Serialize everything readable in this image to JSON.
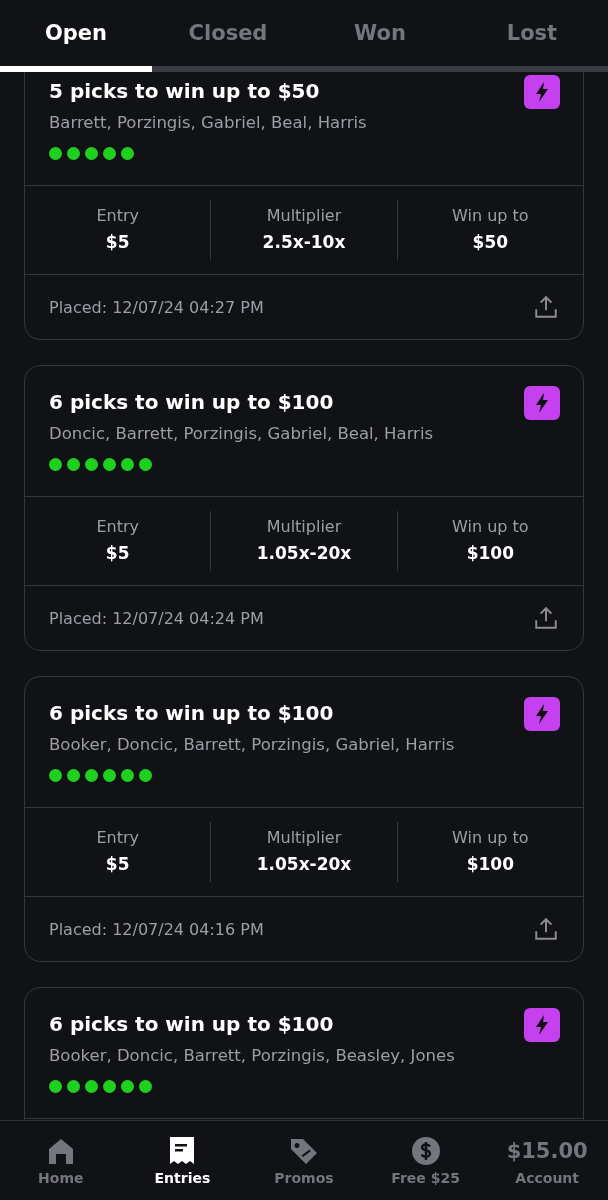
{
  "tabs": [
    {
      "label": "Open",
      "selected": true
    },
    {
      "label": "Closed",
      "selected": false
    },
    {
      "label": "Won",
      "selected": false
    },
    {
      "label": "Lost",
      "selected": false
    }
  ],
  "entries": [
    {
      "title": "5 picks to win up to $50",
      "players": "Barrett, Porzingis, Gabriel, Beal, Harris",
      "legs": [
        {
          "color": "#1fd11f"
        },
        {
          "color": "#1fd11f"
        },
        {
          "color": "#1fd11f"
        },
        {
          "color": "#1fd11f"
        },
        {
          "color": "#1fd11f"
        }
      ],
      "stats": [
        {
          "label": "Entry",
          "value": "$5"
        },
        {
          "label": "Multiplier",
          "value": "2.5x-10x"
        },
        {
          "label": "Win up to",
          "value": "$50"
        }
      ],
      "placed": "Placed: 12/07/24 04:27 PM"
    },
    {
      "title": "6 picks to win up to $100",
      "players": "Doncic, Barrett, Porzingis, Gabriel, Beal, Harris",
      "legs": [
        {
          "color": "#1fd11f"
        },
        {
          "color": "#1fd11f"
        },
        {
          "color": "#1fd11f"
        },
        {
          "color": "#1fd11f"
        },
        {
          "color": "#1fd11f"
        },
        {
          "color": "#1fd11f"
        }
      ],
      "stats": [
        {
          "label": "Entry",
          "value": "$5"
        },
        {
          "label": "Multiplier",
          "value": "1.05x-20x"
        },
        {
          "label": "Win up to",
          "value": "$100"
        }
      ],
      "placed": "Placed: 12/07/24 04:24 PM"
    },
    {
      "title": "6 picks to win up to $100",
      "players": "Booker, Doncic, Barrett, Porzingis, Gabriel, Harris",
      "legs": [
        {
          "color": "#1fd11f"
        },
        {
          "color": "#1fd11f"
        },
        {
          "color": "#1fd11f"
        },
        {
          "color": "#1fd11f"
        },
        {
          "color": "#1fd11f"
        },
        {
          "color": "#1fd11f"
        }
      ],
      "stats": [
        {
          "label": "Entry",
          "value": "$5"
        },
        {
          "label": "Multiplier",
          "value": "1.05x-20x"
        },
        {
          "label": "Win up to",
          "value": "$100"
        }
      ],
      "placed": "Placed: 12/07/24 04:16 PM"
    },
    {
      "title": "6 picks to win up to $100",
      "players": "Booker, Doncic, Barrett, Porzingis, Beasley, Jones",
      "legs": [
        {
          "color": "#1fd11f"
        },
        {
          "color": "#1fd11f"
        },
        {
          "color": "#1fd11f"
        },
        {
          "color": "#1fd11f"
        },
        {
          "color": "#1fd11f"
        },
        {
          "color": "#1fd11f"
        }
      ]
    }
  ],
  "nav": [
    {
      "kind": "home",
      "label": "Home",
      "selected": false
    },
    {
      "kind": "entries",
      "label": "Entries",
      "selected": true
    },
    {
      "kind": "promos",
      "label": "Promos",
      "selected": false
    },
    {
      "kind": "dollar",
      "label": "Free $25",
      "selected": false
    },
    {
      "kind": "balance",
      "balance": "$15.00",
      "label": "Account",
      "selected": false
    }
  ]
}
